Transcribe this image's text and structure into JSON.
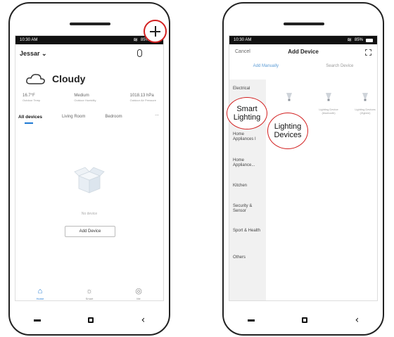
{
  "left_phone": {
    "status": {
      "time": "10:30 AM",
      "battery": "85%"
    },
    "header": {
      "home_name": "Jessar"
    },
    "weather": {
      "condition": "Cloudy"
    },
    "stats": [
      {
        "value": "16.7°F",
        "label": "Outdoor Temp"
      },
      {
        "value": "Medium",
        "label": "Outdoor Humidity"
      },
      {
        "value": "1018.13 hPa",
        "label": "Outdoor Air Pressure"
      }
    ],
    "tabs": [
      "All devices",
      "Living Room",
      "Bedroom"
    ],
    "more": "...",
    "empty_text": "No device",
    "add_device_label": "Add Device",
    "bottom_tabs": [
      {
        "label": "Home",
        "icon": "home-icon",
        "active": true
      },
      {
        "label": "Smart",
        "icon": "sun-icon",
        "active": false
      },
      {
        "label": "Me",
        "icon": "user-icon",
        "active": false
      }
    ]
  },
  "right_phone": {
    "status": {
      "time": "10:30 AM",
      "battery": "85%"
    },
    "header": {
      "cancel": "Cancel",
      "title": "Add Device"
    },
    "tabs": {
      "manual": "Add Manually",
      "search": "Search Device"
    },
    "categories": [
      "Electrical",
      "Home Appliances I",
      "Home Appliance...",
      "Kitchen",
      "Security & Sensor",
      "Sport & Health",
      "Others"
    ],
    "products": [
      {
        "label": ""
      },
      {
        "label": "Lighting Device (bluetooth)"
      },
      {
        "label": "Lighting Devices (Zigbee)"
      }
    ],
    "callouts": {
      "smart_lighting": "Smart Lighting",
      "lighting_devices": "Lighting Devices"
    }
  },
  "colors": {
    "accent": "#1e78d2",
    "callout_red": "#d21f1f"
  }
}
